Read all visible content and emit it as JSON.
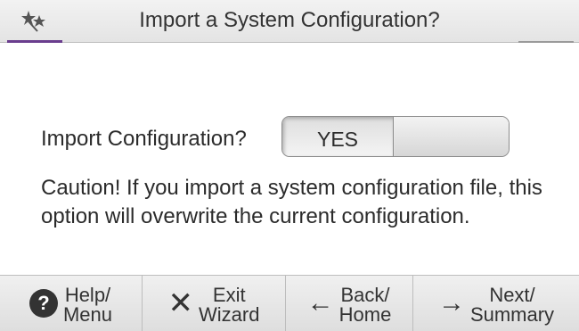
{
  "header": {
    "title": "Import a System Configuration?",
    "icon": "wizard-icon"
  },
  "import": {
    "label": "Import Configuration?",
    "toggle_selected": "YES"
  },
  "caution": {
    "text": "Caution! If you import a system configuration file, this option will overwrite the current configuration."
  },
  "footer": {
    "help": {
      "line1": "Help/",
      "line2": "Menu",
      "icon": "question-icon"
    },
    "exit": {
      "line1": "Exit",
      "line2": "Wizard",
      "icon": "close-icon"
    },
    "back": {
      "line1": "Back/",
      "line2": "Home",
      "icon": "arrow-left-icon"
    },
    "next": {
      "line1": "Next/",
      "line2": "Summary",
      "icon": "arrow-right-icon"
    }
  },
  "colors": {
    "accent": "#6a3d8e",
    "dark_icon": "#333333"
  }
}
